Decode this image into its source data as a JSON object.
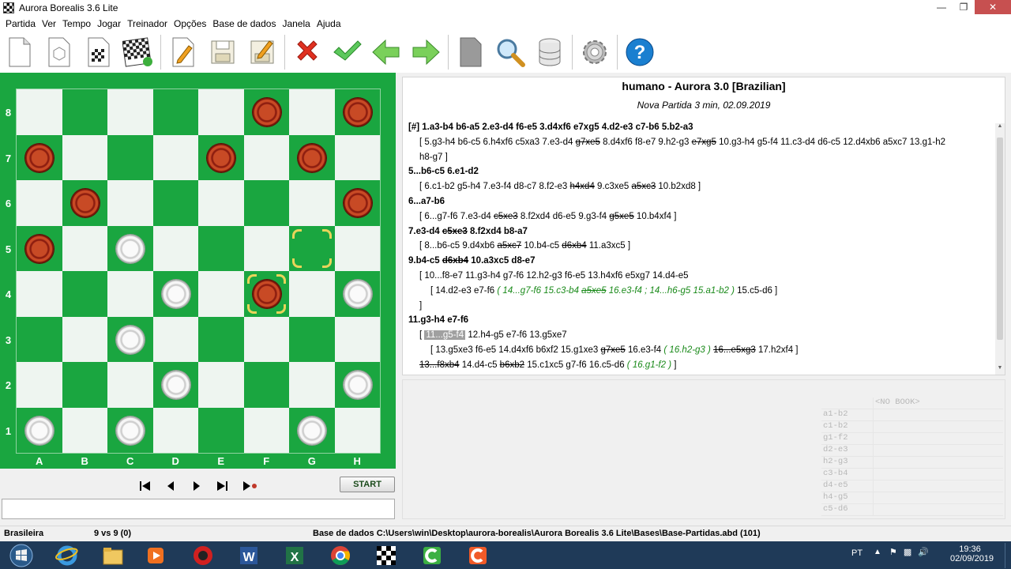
{
  "window": {
    "title": "Aurora Borealis 3.6 Lite",
    "controls": [
      "minimize",
      "maximize",
      "close"
    ]
  },
  "menu": [
    "Partida",
    "Ver",
    "Tempo",
    "Jogar",
    "Treinador",
    "Opções",
    "Base de dados",
    "Janela",
    "Ajuda"
  ],
  "toolbar_icons": [
    "new-document-icon",
    "rotate-board-icon",
    "board-setup-icon",
    "flip-board-icon",
    "edit-icon",
    "save-icon",
    "save-as-icon",
    "delete-icon",
    "accept-icon",
    "back-arrow-icon",
    "forward-arrow-icon",
    "bookmark-icon",
    "search-icon",
    "database-icon",
    "settings-icon",
    "help-icon"
  ],
  "board": {
    "ranks": [
      "8",
      "7",
      "6",
      "5",
      "4",
      "3",
      "2",
      "1"
    ],
    "files": [
      "A",
      "B",
      "C",
      "D",
      "E",
      "F",
      "G",
      "H"
    ],
    "pieces": [
      {
        "square": "f8",
        "color": "red"
      },
      {
        "square": "h8",
        "color": "red"
      },
      {
        "square": "a7",
        "color": "red"
      },
      {
        "square": "e7",
        "color": "red"
      },
      {
        "square": "g7",
        "color": "red"
      },
      {
        "square": "b6",
        "color": "red"
      },
      {
        "square": "h6",
        "color": "red"
      },
      {
        "square": "a5",
        "color": "red"
      },
      {
        "square": "c5",
        "color": "white"
      },
      {
        "square": "d4",
        "color": "white"
      },
      {
        "square": "f4",
        "color": "red"
      },
      {
        "square": "h4",
        "color": "white"
      },
      {
        "square": "c3",
        "color": "white"
      },
      {
        "square": "d2",
        "color": "white"
      },
      {
        "square": "h2",
        "color": "white"
      },
      {
        "square": "a1",
        "color": "white"
      },
      {
        "square": "c1",
        "color": "white"
      },
      {
        "square": "g1",
        "color": "white"
      }
    ],
    "highlighted_squares": [
      "g5",
      "f4"
    ]
  },
  "nav": {
    "buttons": [
      "first-move-icon",
      "prev-move-icon",
      "next-move-icon",
      "last-move-icon",
      "play-moves-icon"
    ],
    "start_label": "START"
  },
  "game": {
    "title": "humano - Aurora 3.0 [Brazilian]",
    "subtitle": "Nova Partida 3 min, 02.09.2019"
  },
  "moves": [
    {
      "indent": 0,
      "bold": true,
      "parts": [
        {
          "t": "[#] 1.a3-b4 b6-a5 2.e3-d4 f6-e5 3.d4xf6 e7xg5 4.d2-e3 c7-b6 5.b2-a3"
        }
      ]
    },
    {
      "indent": 1,
      "parts": [
        {
          "t": "[ 5.g3-h4 b6-c5 6.h4xf6 c5xa3 7.e3-d4 "
        },
        {
          "t": "g7xe5",
          "s": true
        },
        {
          "t": " 8.d4xf6 f8-e7 9.h2-g3 "
        },
        {
          "t": "e7xg5",
          "s": true
        },
        {
          "t": " 10.g3-h4 g5-f4 11.c3-d4 d6-c5 12.d4xb6 a5xc7 13.g1-h2"
        }
      ]
    },
    {
      "indent": 1,
      "parts": [
        {
          "t": "h8-g7 ]"
        }
      ]
    },
    {
      "indent": 0,
      "bold": true,
      "parts": [
        {
          "t": "5...b6-c5 6.e1-d2"
        }
      ]
    },
    {
      "indent": 1,
      "parts": [
        {
          "t": "[ 6.c1-b2 g5-h4 7.e3-f4 d8-c7 8.f2-e3 "
        },
        {
          "t": "h4xd4",
          "s": true
        },
        {
          "t": " 9.c3xe5 "
        },
        {
          "t": "a5xc3",
          "s": true
        },
        {
          "t": " 10.b2xd8 ]"
        }
      ]
    },
    {
      "indent": 0,
      "bold": true,
      "parts": [
        {
          "t": "6...a7-b6"
        }
      ]
    },
    {
      "indent": 1,
      "parts": [
        {
          "t": "[ 6...g7-f6 7.e3-d4 "
        },
        {
          "t": "c5xe3",
          "s": true
        },
        {
          "t": " 8.f2xd4 d6-e5 9.g3-f4 "
        },
        {
          "t": "g5xe5",
          "s": true
        },
        {
          "t": " 10.b4xf4 ]"
        }
      ]
    },
    {
      "indent": 0,
      "bold": true,
      "parts": [
        {
          "t": "7.e3-d4 "
        },
        {
          "t": "c5xe3",
          "s": true
        },
        {
          "t": " 8.f2xd4 b8-a7"
        }
      ]
    },
    {
      "indent": 1,
      "parts": [
        {
          "t": "[ 8...b6-c5 9.d4xb6 "
        },
        {
          "t": "a5xc7",
          "s": true
        },
        {
          "t": " 10.b4-c5 "
        },
        {
          "t": "d6xb4",
          "s": true
        },
        {
          "t": " 11.a3xc5 ]"
        }
      ]
    },
    {
      "indent": 0,
      "bold": true,
      "parts": [
        {
          "t": "9.b4-c5 "
        },
        {
          "t": "d6xb4",
          "s": true
        },
        {
          "t": " 10.a3xc5 d8-e7"
        }
      ]
    },
    {
      "indent": 1,
      "parts": [
        {
          "t": "[ 10...f8-e7 11.g3-h4 g7-f6 12.h2-g3 f6-e5 13.h4xf6 e5xg7 14.d4-e5"
        }
      ]
    },
    {
      "indent": 2,
      "parts": [
        {
          "t": "[ 14.d2-e3 e7-f6 "
        },
        {
          "t": "( 14...g7-f6 15.c3-b4 ",
          "g": true
        },
        {
          "t": "a5xe5",
          "g": true,
          "s": true
        },
        {
          "t": " 16.e3-f4 ; 14...h6-g5 15.a1-b2 )",
          "g": true
        },
        {
          "t": " 15.c5-d6 ]"
        }
      ]
    },
    {
      "indent": 1,
      "parts": [
        {
          "t": "]"
        }
      ]
    },
    {
      "indent": 0,
      "bold": true,
      "parts": [
        {
          "t": "11.g3-h4 e7-f6"
        }
      ]
    },
    {
      "indent": 1,
      "parts": [
        {
          "t": "[ "
        },
        {
          "t": "11...g5-f4",
          "hl": true
        },
        {
          "t": " 12.h4-g5 e7-f6 13.g5xe7"
        }
      ]
    },
    {
      "indent": 2,
      "parts": [
        {
          "t": "[ 13.g5xe3 f6-e5 14.d4xf6 b6xf2 15.g1xe3 "
        },
        {
          "t": "g7xe5",
          "s": true
        },
        {
          "t": " 16.e3-f4 "
        },
        {
          "t": "( 16.h2-g3 )",
          "g": true
        },
        {
          "t": " "
        },
        {
          "t": "16...e5xg3",
          "s": true
        },
        {
          "t": " 17.h2xf4 ]"
        }
      ]
    },
    {
      "indent": 1,
      "parts": [
        {
          "t": "13...f8xb4",
          "s": true
        },
        {
          "t": " 14.d4-c5 "
        },
        {
          "t": "b6xb2",
          "s": true
        },
        {
          "t": " 15.c1xc5 g7-f6 16.c5-d6 "
        },
        {
          "t": "( 16.g1-f2 )",
          "g": true
        },
        {
          "t": " ]"
        }
      ]
    }
  ],
  "book": {
    "header": "<NO BOOK>",
    "moves": [
      "a1-b2",
      "c1-b2",
      "g1-f2",
      "d2-e3",
      "h2-g3",
      "c3-b4",
      "d4-e5",
      "h4-g5",
      "c5-d6"
    ]
  },
  "status": {
    "variant": "Brasileira",
    "score": "9 vs 9  (0)",
    "db": "Base de dados C:\\Users\\win\\Desktop\\aurora-borealis\\Aurora Borealis 3.6 Lite\\Bases\\Base-Partidas.abd (101)"
  },
  "taskbar": {
    "apps": [
      "start-button-icon",
      "internet-explorer-icon",
      "file-explorer-icon",
      "media-player-icon",
      "security-app-icon",
      "word-icon",
      "excel-icon",
      "chrome-icon",
      "aurora-app-icon",
      "green-c-app-icon",
      "orange-c-app-icon"
    ],
    "lang": "PT",
    "time": "19:36",
    "date": "02/09/2019"
  }
}
